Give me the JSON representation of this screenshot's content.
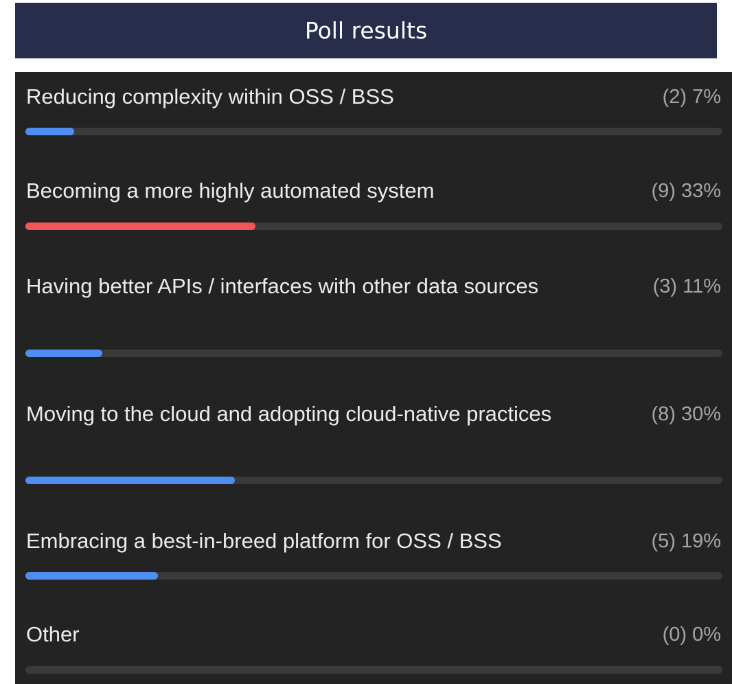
{
  "header": {
    "title": "Poll results"
  },
  "options": [
    {
      "label": "Reducing complexity within OSS / BSS",
      "stat": "(2) 7%",
      "fraction": 0.07,
      "color": "#4d8ef0"
    },
    {
      "label": "Becoming a more highly automated system",
      "stat": "(9) 33%",
      "fraction": 0.33,
      "color": "#f25656"
    },
    {
      "label": "Having better APIs / interfaces with other data sources",
      "stat": "(3) 11%",
      "fraction": 0.11,
      "color": "#4d8ef0"
    },
    {
      "label": "Moving to the cloud and adopting cloud-native practices",
      "stat": "(8) 30%",
      "fraction": 0.3,
      "color": "#4d8ef0"
    },
    {
      "label": "Embracing a best-in-breed platform for OSS / BSS",
      "stat": "(5) 19%",
      "fraction": 0.19,
      "color": "#4d8ef0"
    },
    {
      "label": "Other",
      "stat": "(0) 0%",
      "fraction": 0,
      "color": "#4d8ef0"
    }
  ],
  "colors": {
    "header_bg": "#272d4a",
    "panel_bg": "#232323",
    "track": "#3a3a3a",
    "highlight": "#f25656",
    "accent": "#4d8ef0"
  }
}
